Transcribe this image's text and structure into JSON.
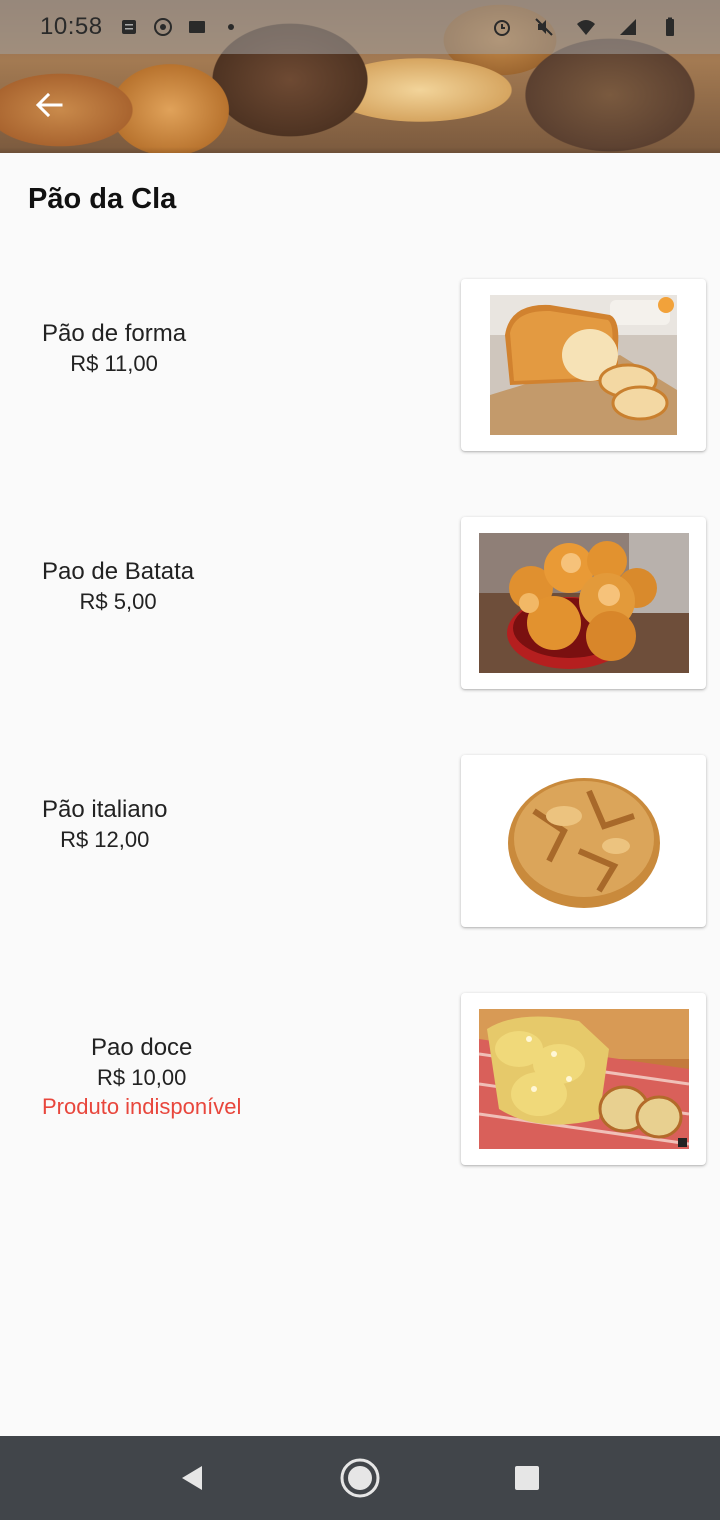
{
  "status_bar": {
    "time": "10:58"
  },
  "header": {
    "title": "Pão da Cla"
  },
  "products": [
    {
      "name": "Pão de forma",
      "price": "R$ 11,00",
      "status": ""
    },
    {
      "name": "Pao de Batata",
      "price": "R$ 5,00",
      "status": ""
    },
    {
      "name": "Pão italiano",
      "price": "R$ 12,00",
      "status": ""
    },
    {
      "name": "Pao doce",
      "price": "R$ 10,00",
      "status": "Produto indisponível"
    }
  ],
  "colors": {
    "unavailable": "#e8463c",
    "nav_bar": "#41454a",
    "background": "#fafafa"
  },
  "icons": {
    "back": "arrow-left-icon",
    "nav_back": "triangle-back-icon",
    "nav_home": "circle-home-icon",
    "nav_recents": "square-recents-icon"
  }
}
